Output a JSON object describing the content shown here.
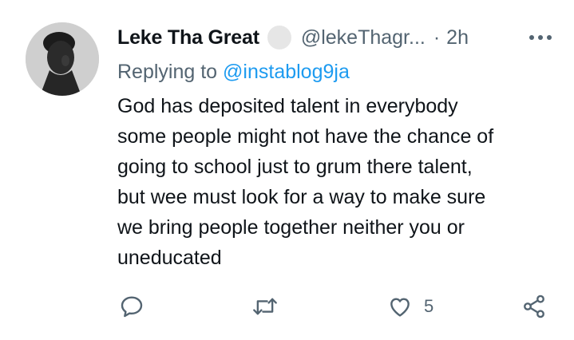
{
  "author": {
    "display_name": "Leke Tha Great",
    "handle": "@lekeThagr...",
    "separator": "·",
    "time": "2h"
  },
  "reply": {
    "prefix": "Replying to",
    "mention": "@instablog9ja"
  },
  "body_lines": [
    "God has deposited talent in everybody",
    "some people might not have the chance of",
    "going to school just to grum there talent,",
    "but wee must look for a way to make sure",
    "we bring people together neither you or",
    "uneducated"
  ],
  "actions": {
    "reply_icon": "reply-icon",
    "retweet_icon": "retweet-icon",
    "like_icon": "heart-icon",
    "like_count": "5",
    "share_icon": "share-icon"
  },
  "colors": {
    "text": "#0f1419",
    "secondary": "#536471",
    "link": "#1d9bf0"
  }
}
